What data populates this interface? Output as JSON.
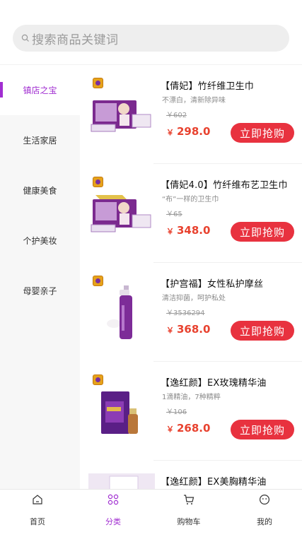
{
  "search": {
    "placeholder": "搜索商品关键词",
    "icon": "search-icon"
  },
  "sidebar": {
    "items": [
      {
        "label": "镇店之宝",
        "active": true
      },
      {
        "label": "生活家居",
        "active": false
      },
      {
        "label": "健康美食",
        "active": false
      },
      {
        "label": "个护美妆",
        "active": false
      },
      {
        "label": "母婴亲子",
        "active": false
      }
    ]
  },
  "products": [
    {
      "title": "【倩妃】竹纤维卫生巾",
      "subtitle": "不漂白，清新除异味",
      "old_price": "￥602",
      "currency": "￥",
      "price": "298.0",
      "buy_label": "立即抢购"
    },
    {
      "title": "【倩妃4.0】竹纤维布艺卫生巾",
      "subtitle": "“布”一样的卫生巾",
      "old_price": "￥65",
      "currency": "￥",
      "price": "348.0",
      "buy_label": "立即抢购"
    },
    {
      "title": "【护宫福】女性私护摩丝",
      "subtitle": "清洁抑菌，呵护私处",
      "old_price": "￥3536294",
      "currency": "￥",
      "price": "368.0",
      "buy_label": "立即抢购"
    },
    {
      "title": "【逸红颜】EX玫瑰精华油",
      "subtitle": "1滴精油，7种精粹",
      "old_price": "￥106",
      "currency": "￥",
      "price": "268.0",
      "buy_label": "立即抢购"
    },
    {
      "title": "【逸红颜】EX美胸精华油"
    }
  ],
  "tabbar": {
    "tabs": [
      {
        "label": "首页",
        "icon": "home-icon"
      },
      {
        "label": "分类",
        "icon": "category-icon",
        "active": true
      },
      {
        "label": "购物车",
        "icon": "cart-icon"
      },
      {
        "label": "我的",
        "icon": "profile-icon"
      }
    ]
  },
  "colors": {
    "accent": "#a12ed1",
    "price": "#e8422f",
    "buy_button": "#e8323f"
  }
}
